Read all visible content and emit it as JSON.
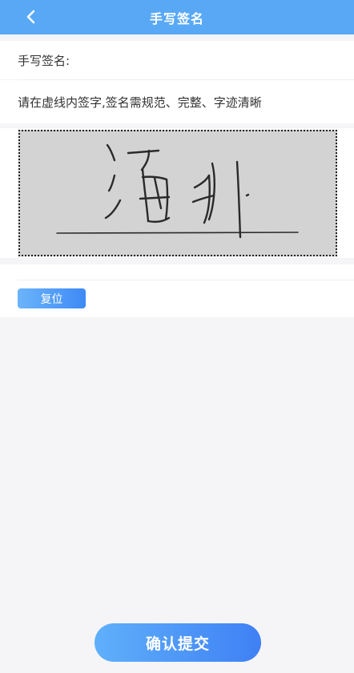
{
  "header": {
    "title": "手写签名",
    "back_icon": "chevron-left-icon"
  },
  "form": {
    "signature_label": "手写签名:",
    "instruction": "请在虚线内签字,签名需规范、完整、字迹清晰"
  },
  "signature_pad": {
    "background": "#d3d3d3",
    "has_signature": true
  },
  "actions": {
    "reset_label": "复位",
    "submit_label": "确认提交"
  },
  "colors": {
    "accent": "#58a8f6",
    "button_gradient_start": "#5fb0fb",
    "button_gradient_end": "#3f80f5"
  }
}
